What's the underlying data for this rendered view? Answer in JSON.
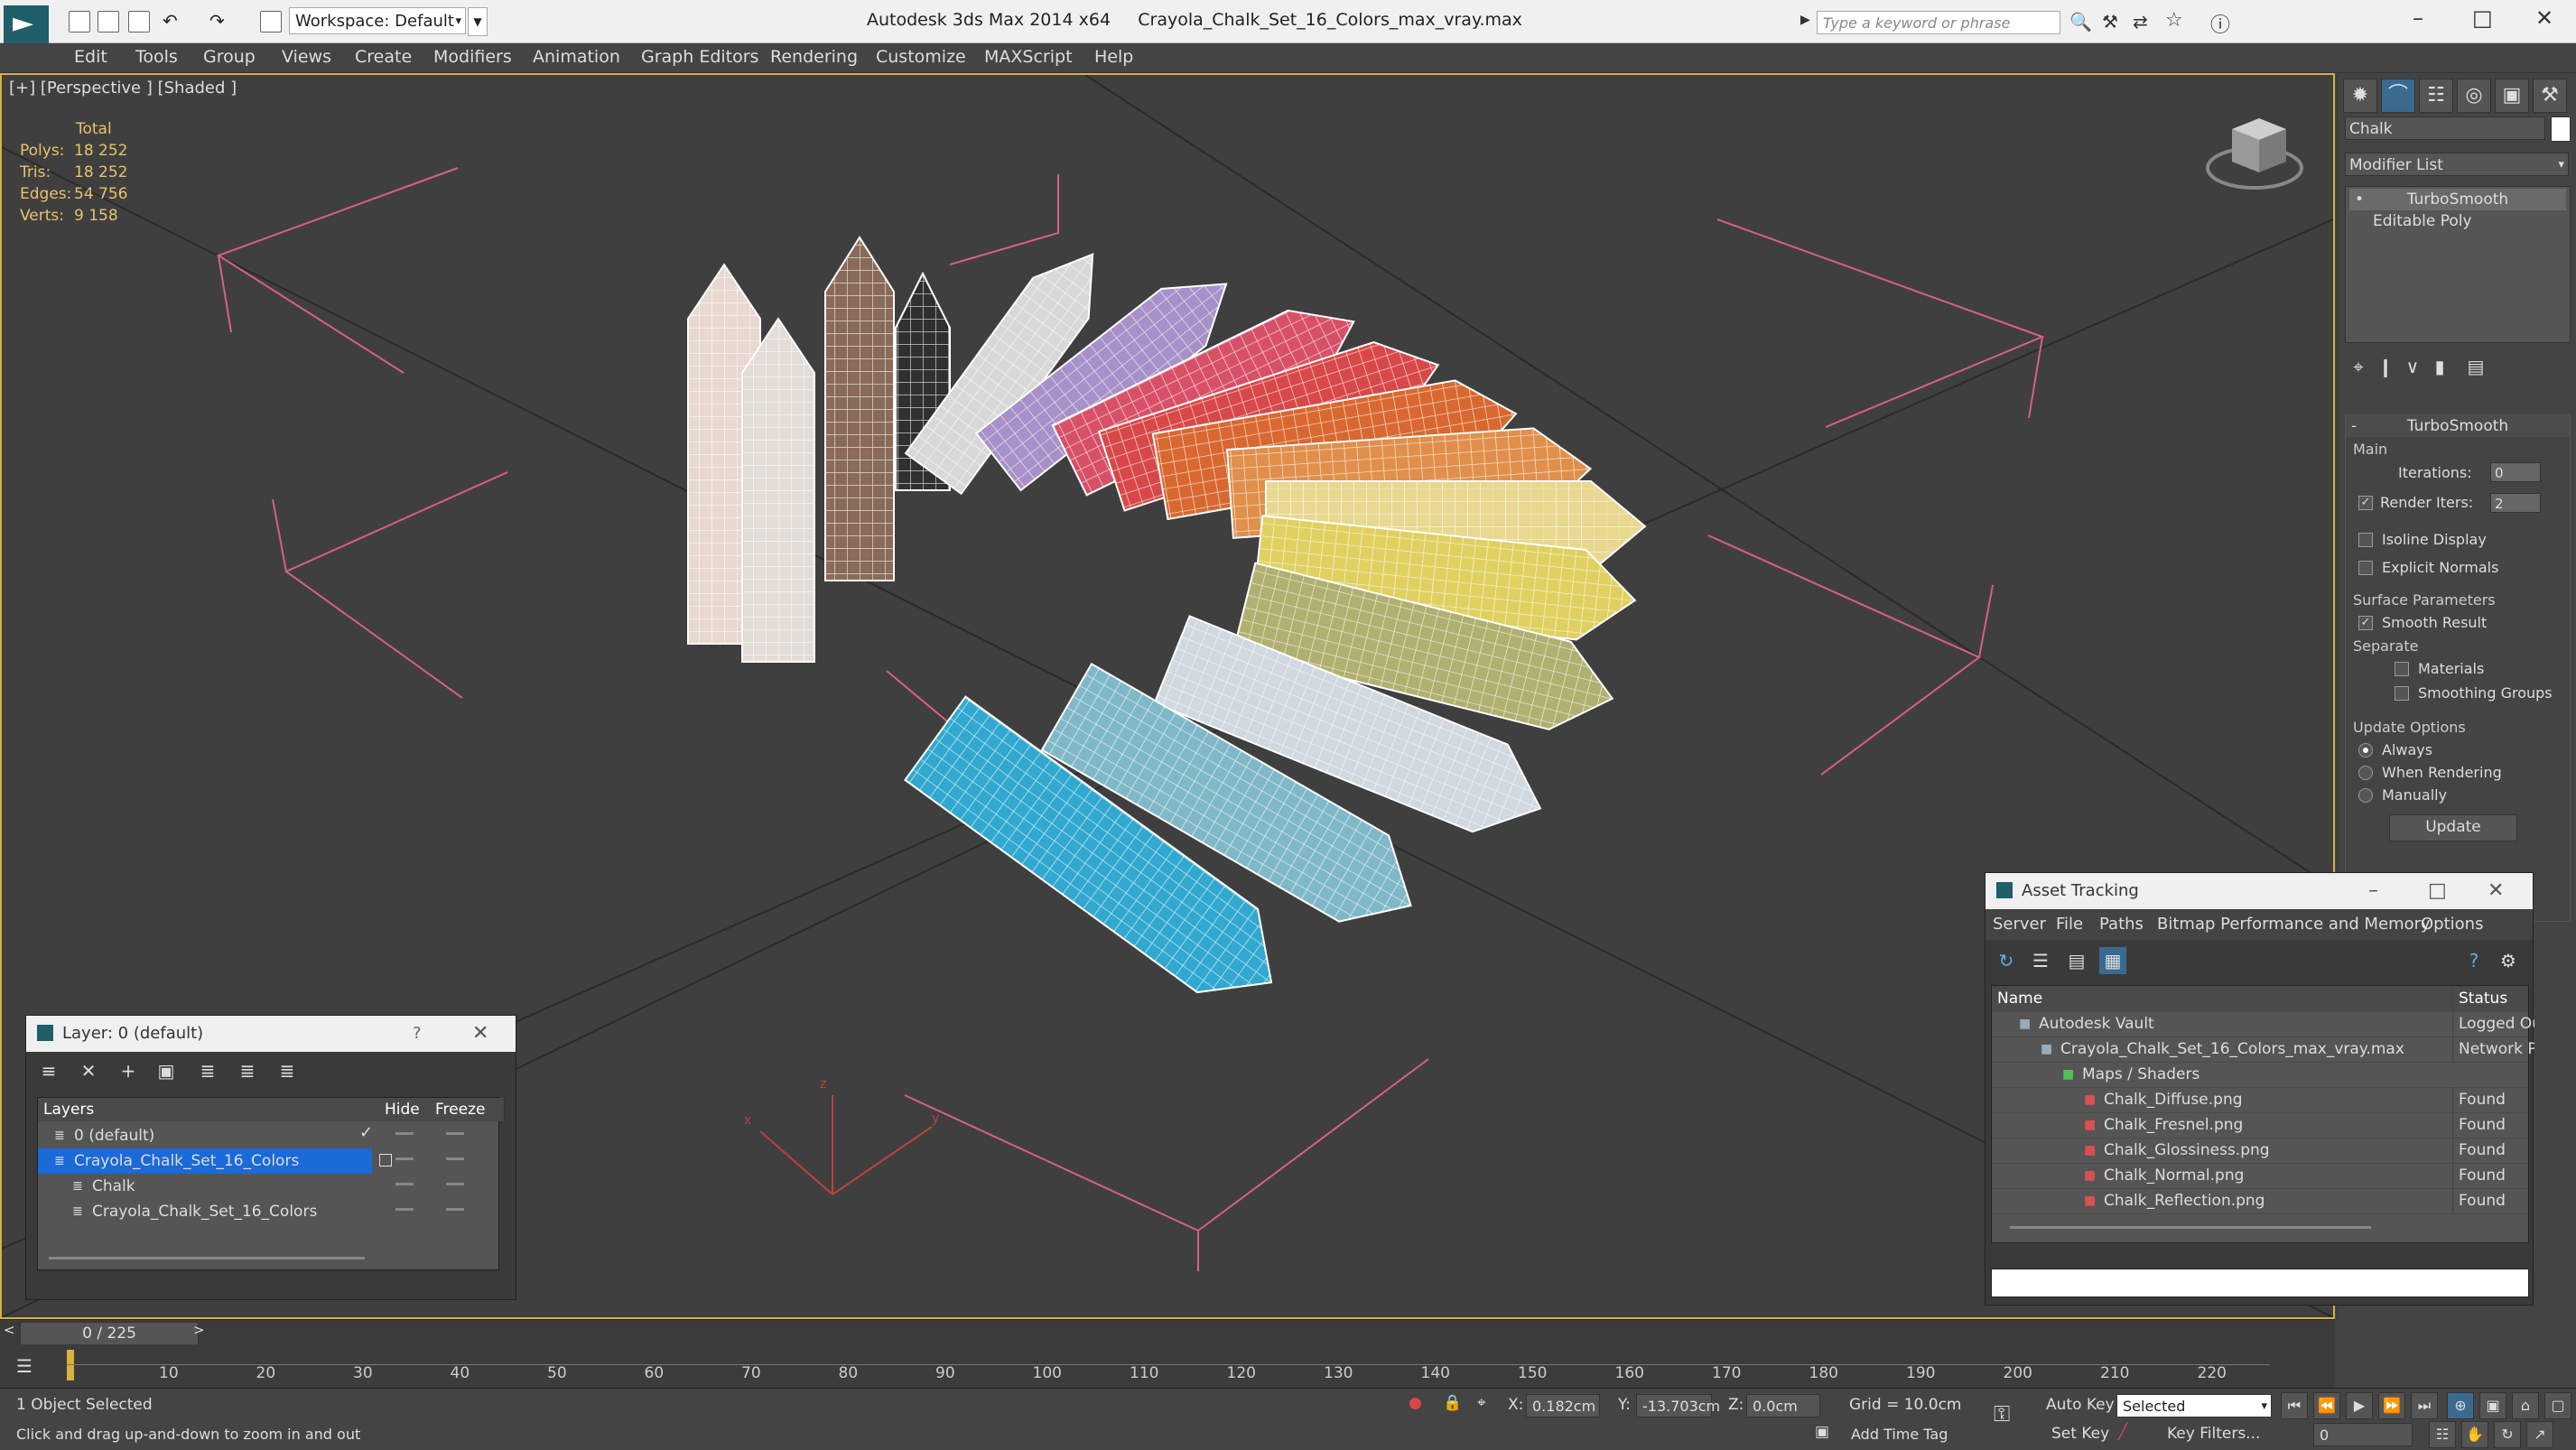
{
  "titlebar": {
    "workspace": "Workspace: Default",
    "app_name": "Autodesk 3ds Max  2014 x64",
    "file_name": "Crayola_Chalk_Set_16_Colors_max_vray.max",
    "search_placeholder": "Type a keyword or phrase"
  },
  "menu": [
    "Edit",
    "Tools",
    "Group",
    "Views",
    "Create",
    "Modifiers",
    "Animation",
    "Graph Editors",
    "Rendering",
    "Customize",
    "MAXScript",
    "Help"
  ],
  "viewport": {
    "label": "[+] [Perspective ] [Shaded ]",
    "stats": {
      "header": "Total",
      "rows": [
        {
          "label": "Polys:",
          "value": "18 252"
        },
        {
          "label": "Tris:",
          "value": "18 252"
        },
        {
          "label": "Edges:",
          "value": "54 756"
        },
        {
          "label": "Verts:",
          "value": "9 158"
        }
      ]
    },
    "axis_x": "x",
    "axis_y": "y",
    "axis_z": "z"
  },
  "chalks": [
    {
      "color": "#e8d8d0"
    },
    {
      "color": "#e4dcd6"
    },
    {
      "color": "#8a6a58"
    },
    {
      "color": "#303030"
    },
    {
      "color": "#d8d8d8"
    },
    {
      "color": "#a890c8"
    },
    {
      "color": "#d85068"
    },
    {
      "color": "#d84848"
    },
    {
      "color": "#d86830"
    },
    {
      "color": "#e0904a"
    },
    {
      "color": "#e8d890"
    },
    {
      "color": "#e0d060"
    },
    {
      "color": "#b0b070"
    },
    {
      "color": "#d0d8e0"
    },
    {
      "color": "#80b8c8"
    },
    {
      "color": "#30a8d0"
    }
  ],
  "command_panel": {
    "object_name": "Chalk",
    "modifier_list": "Modifier List",
    "stack": [
      "TurboSmooth",
      "Editable Poly"
    ],
    "turbosmooth": {
      "title": "TurboSmooth",
      "main_label": "Main",
      "iterations_label": "Iterations:",
      "iterations_value": "0",
      "render_iters_label": "Render Iters:",
      "render_iters_value": "2",
      "isoline": "Isoline Display",
      "explicit": "Explicit Normals",
      "surface_params": "Surface Parameters",
      "smooth_result": "Smooth Result",
      "separate": "Separate",
      "materials": "Materials",
      "smoothing_groups": "Smoothing Groups",
      "update_options": "Update Options",
      "always": "Always",
      "when_rendering": "When Rendering",
      "manually": "Manually",
      "update_button": "Update"
    }
  },
  "layer_dialog": {
    "title": "Layer: 0 (default)",
    "help": "?",
    "columns": [
      "Layers",
      "Hide",
      "Freeze"
    ],
    "rows": [
      {
        "name": "0 (default)",
        "indent": 0,
        "selected": false
      },
      {
        "name": "Crayola_Chalk_Set_16_Colors",
        "indent": 0,
        "selected": true
      },
      {
        "name": "Chalk",
        "indent": 1,
        "selected": false
      },
      {
        "name": "Crayola_Chalk_Set_16_Colors",
        "indent": 1,
        "selected": false
      }
    ]
  },
  "asset_dialog": {
    "title": "Asset Tracking",
    "menu": [
      "Server",
      "File",
      "Paths",
      "Bitmap Performance and Memory",
      "Options"
    ],
    "columns": [
      "Name",
      "Status"
    ],
    "rows": [
      {
        "name": "Autodesk Vault",
        "status": "Logged Out",
        "indent": 1
      },
      {
        "name": "Crayola_Chalk_Set_16_Colors_max_vray.max",
        "status": "Network P",
        "indent": 2
      },
      {
        "name": "Maps / Shaders",
        "status": "",
        "indent": 3
      },
      {
        "name": "Chalk_Diffuse.png",
        "status": "Found",
        "indent": 4
      },
      {
        "name": "Chalk_Fresnel.png",
        "status": "Found",
        "indent": 4
      },
      {
        "name": "Chalk_Glossiness.png",
        "status": "Found",
        "indent": 4
      },
      {
        "name": "Chalk_Normal.png",
        "status": "Found",
        "indent": 4
      },
      {
        "name": "Chalk_Reflection.png",
        "status": "Found",
        "indent": 4
      }
    ]
  },
  "timeline": {
    "frame_counter": "0 / 225",
    "ticks": [
      "10",
      "20",
      "30",
      "40",
      "50",
      "60",
      "70",
      "80",
      "90",
      "100",
      "110",
      "120",
      "130",
      "140",
      "150",
      "160",
      "170",
      "180",
      "190",
      "200",
      "210",
      "220"
    ]
  },
  "status": {
    "selection": "1 Object Selected",
    "prompt": "Click and drag up-and-down to zoom in and out",
    "x_label": "X:",
    "x_value": "0.182cm",
    "y_label": "Y:",
    "y_value": "-13.703cm",
    "z_label": "Z:",
    "z_value": "0.0cm",
    "grid": "Grid = 10.0cm",
    "add_time_tag": "Add Time Tag",
    "auto_key": "Auto Key",
    "set_key": "Set Key",
    "selected_dropdown": "Selected",
    "key_filters": "Key Filters...",
    "current_frame": "0"
  }
}
